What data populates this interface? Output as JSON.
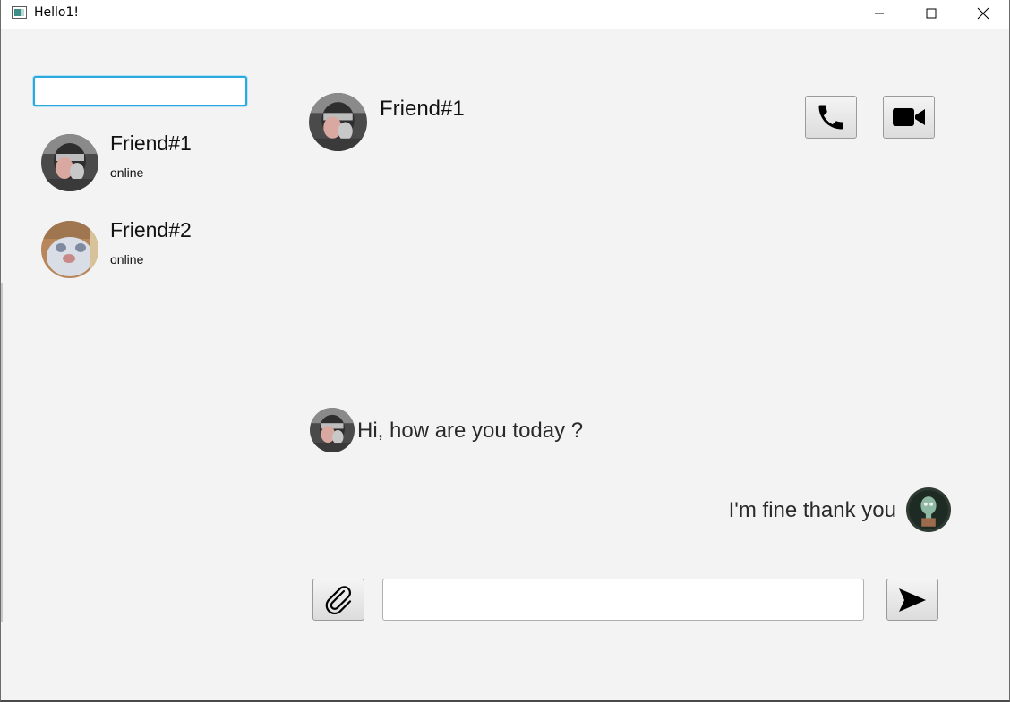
{
  "window": {
    "title": "Hello1!"
  },
  "sidebar": {
    "search": {
      "value": "",
      "placeholder": ""
    },
    "contacts": [
      {
        "name": "Friend#1",
        "status": "online",
        "avatar": "masked-person-avatar"
      },
      {
        "name": "Friend#2",
        "status": "online",
        "avatar": "cat-avatar"
      }
    ]
  },
  "chat": {
    "header": {
      "name": "Friend#1",
      "avatar": "masked-person-avatar"
    },
    "actions": {
      "call_icon": "phone-icon",
      "video_icon": "video-camera-icon"
    },
    "messages": [
      {
        "text": "Hi, how are you today ?",
        "from": "friend",
        "avatar": "masked-person-avatar"
      },
      {
        "text": "I'm fine thank you",
        "from": "me",
        "avatar": "squidward-avatar"
      }
    ],
    "composer": {
      "value": "",
      "placeholder": "",
      "attach_icon": "paperclip-icon",
      "send_icon": "send-icon"
    }
  },
  "colors": {
    "background": "#f3f3f3",
    "focus_border": "#2aa8e0",
    "text": "#111111"
  }
}
